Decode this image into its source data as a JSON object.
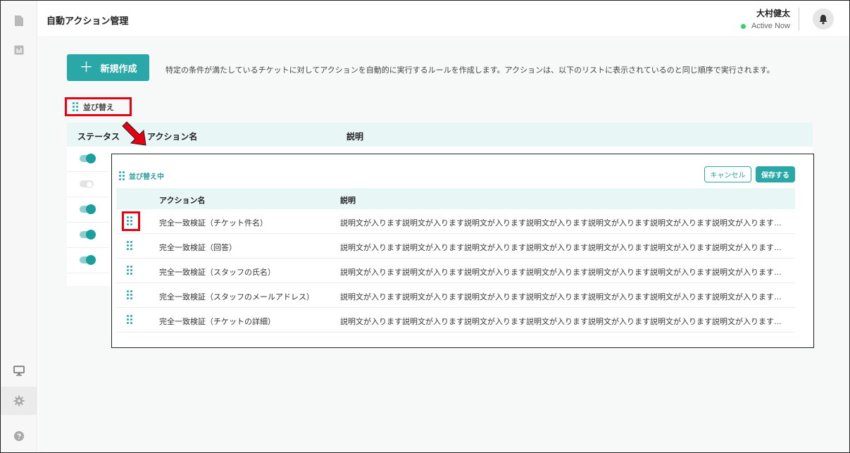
{
  "header": {
    "page_title": "自動アクション管理",
    "user_name": "大村健太",
    "user_status": "Active Now"
  },
  "sidebar": {
    "items": [
      {
        "icon": "document-icon"
      },
      {
        "icon": "bar-chart-icon"
      },
      {
        "icon": "monitor-icon"
      },
      {
        "icon": "gear-icon",
        "active": true
      },
      {
        "icon": "help-icon"
      }
    ]
  },
  "toolbar": {
    "new_label": "新規作成",
    "intro_text": "特定の条件が満たしているチケットに対してアクションを自動的に実行するルールを作成します。アクションは、以下のリストに表示されているのと同じ順序で実行されます。",
    "sort_label": "並び替え"
  },
  "table": {
    "col_status": "ステータス",
    "col_name": "アクション名",
    "col_desc": "説明",
    "statuses": [
      true,
      false,
      true,
      true,
      true
    ]
  },
  "panel": {
    "sorting_label": "並び替え中",
    "cancel_label": "キャンセル",
    "save_label": "保存する",
    "col_name": "アクション名",
    "col_desc": "説明",
    "rows": [
      {
        "name": "完全一致検証（チケット件名）",
        "desc": "説明文が入ります説明文が入ります説明文が入ります説明文が入ります説明文が入ります説明文が入ります説明文が入ります説明文が入ります説明…"
      },
      {
        "name": "完全一致検証（回答）",
        "desc": "説明文が入ります説明文が入ります説明文が入ります説明文が入ります説明文が入ります説明文が入ります説明文が入ります説明文が入ります説明…"
      },
      {
        "name": "完全一致検証（スタッフの氏名）",
        "desc": "説明文が入ります説明文が入ります説明文が入ります説明文が入ります説明文が入ります説明文が入ります説明文が入ります説明文が入ります説明…"
      },
      {
        "name": "完全一致検証（スタッフのメールアドレス）",
        "desc": "説明文が入ります説明文が入ります説明文が入ります説明文が入ります説明文が入ります説明文が入ります説明文が入ります説明文が入ります説明…"
      },
      {
        "name": "完全一致検証（チケットの詳細）",
        "desc": "説明文が入ります説明文が入ります説明文が入ります説明文が入ります説明文が入ります説明文が入ります説明文が入ります説明文が入ります説明…"
      }
    ]
  },
  "colors": {
    "accent": "#2aa8a8",
    "highlight": "#e60012"
  }
}
